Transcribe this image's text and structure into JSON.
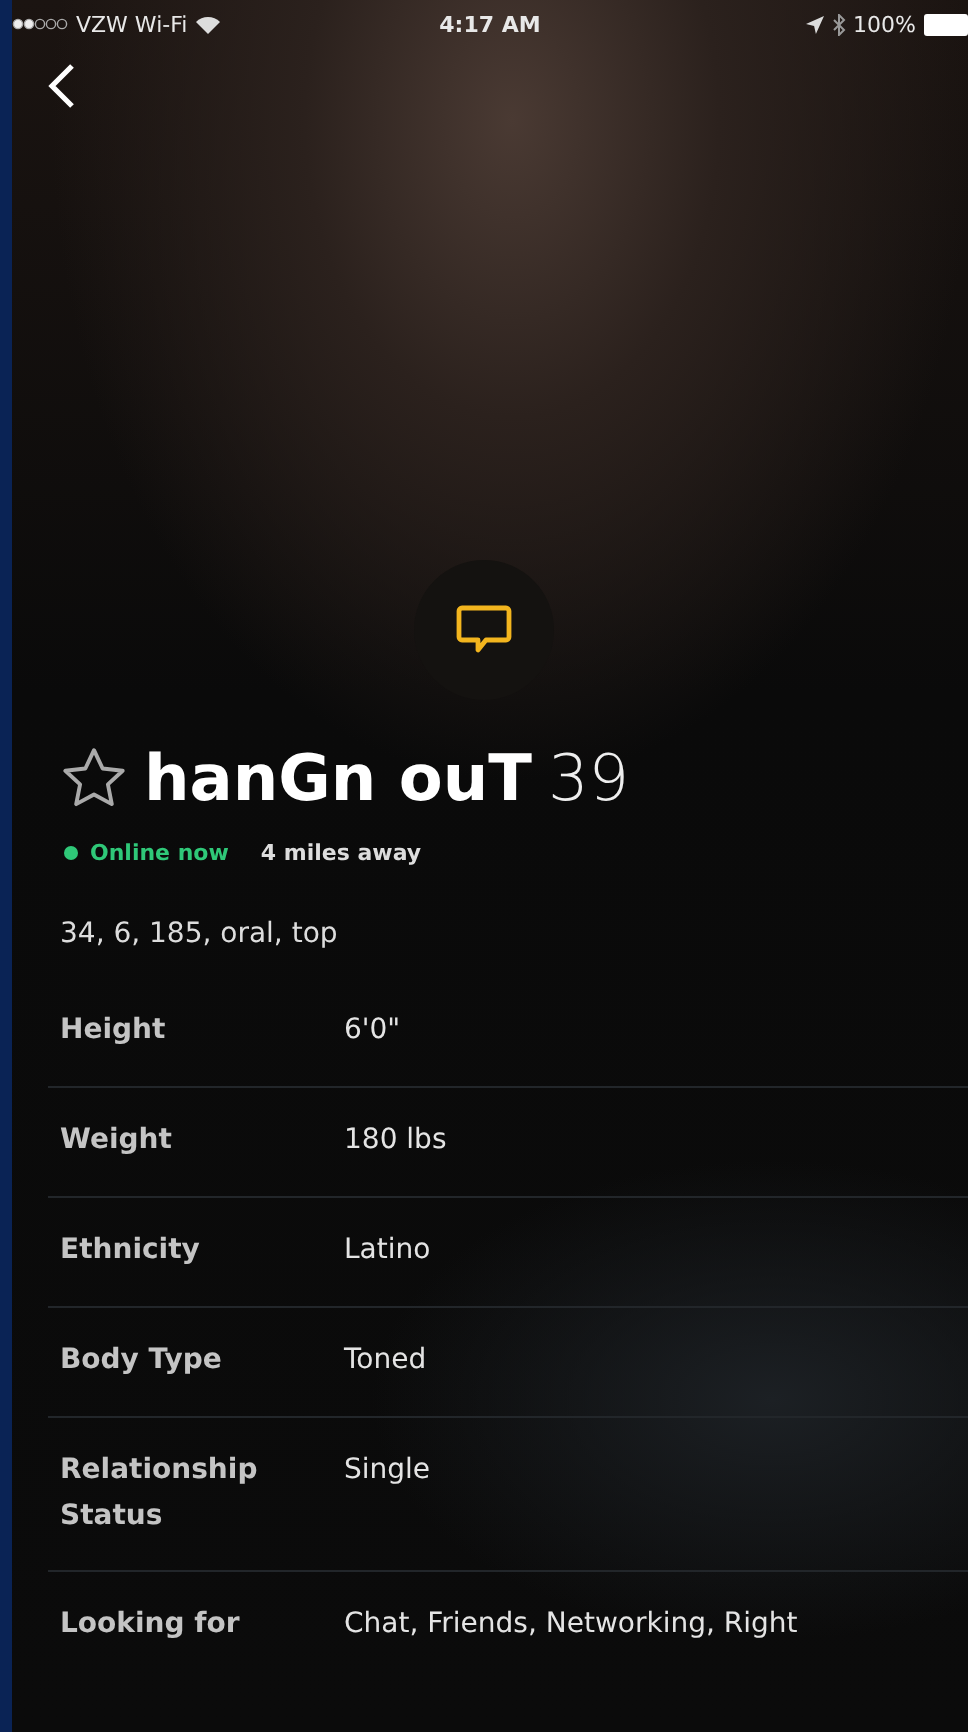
{
  "status_bar": {
    "carrier": "VZW Wi-Fi",
    "time": "4:17 AM",
    "battery": "100%"
  },
  "profile": {
    "name": "hanGn ouT",
    "age": "39",
    "favorited": false,
    "online": true,
    "presence": "Online now",
    "distance": "4 miles away",
    "tagline": "34, 6, 185, oral, top"
  },
  "details": [
    {
      "label": "Height",
      "value": "6'0\""
    },
    {
      "label": "Weight",
      "value": "180 lbs"
    },
    {
      "label": "Ethnicity",
      "value": "Latino"
    },
    {
      "label": "Body Type",
      "value": "Toned"
    },
    {
      "label": "Relationship Status",
      "value": "Single"
    },
    {
      "label": "Looking for",
      "value": "Chat, Friends, Networking, Right"
    }
  ]
}
